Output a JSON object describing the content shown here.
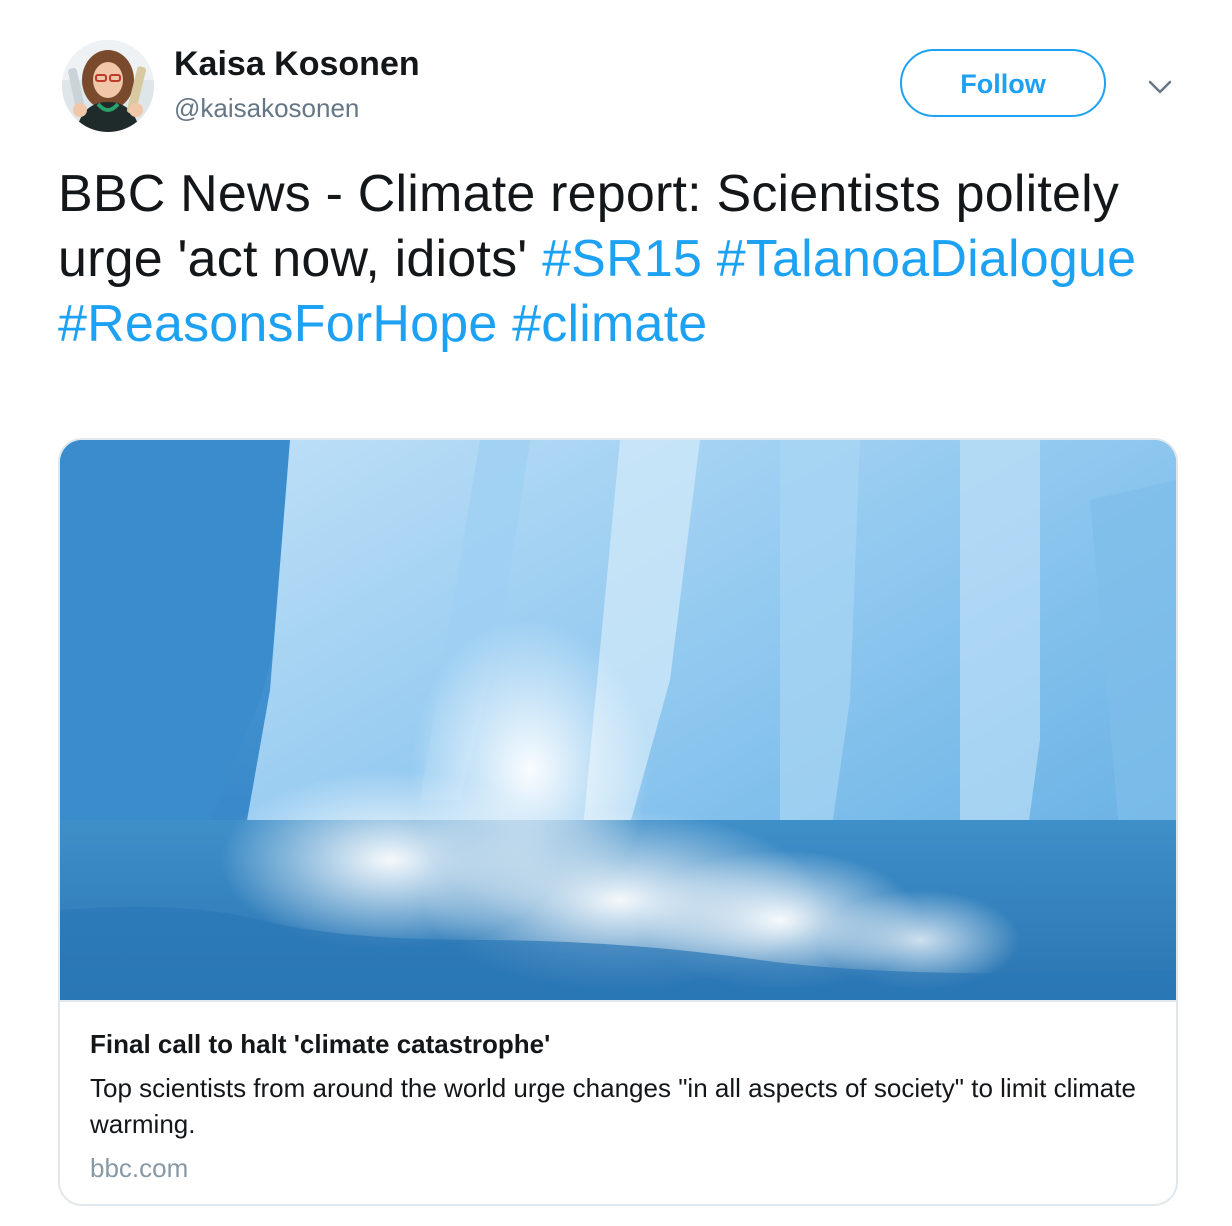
{
  "colors": {
    "accent": "#1da1f2",
    "text_primary": "#14171a",
    "text_secondary": "#657786",
    "border": "#e1e8ed",
    "domain_text": "#8899a6"
  },
  "user": {
    "name": "Kaisa Kosonen",
    "handle": "@kaisakosonen",
    "avatar_icon": "profile-photo"
  },
  "actions": {
    "follow_label": "Follow",
    "menu_icon": "chevron-down-icon"
  },
  "tweet": {
    "text_part1": "BBC News - Climate report: Scientists politely urge 'act now, idiots'",
    "hashtags": [
      "#SR15",
      "#TalanoaDialogue",
      "#ReasonsForHope",
      "#climate"
    ]
  },
  "card": {
    "image_icon": "glacier-calving-photo",
    "title": "Final call to halt 'climate catastrophe'",
    "description": "Top scientists from around the world urge changes \"in all aspects of society\" to limit climate warming.",
    "domain": "bbc.com"
  }
}
